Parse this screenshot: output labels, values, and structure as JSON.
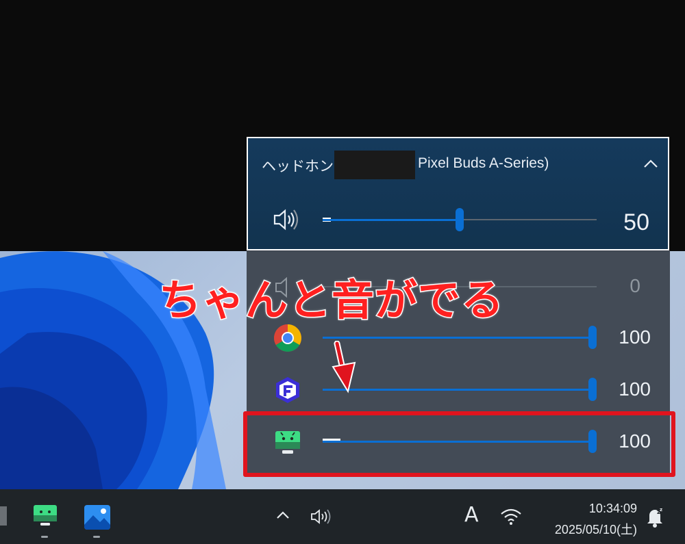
{
  "device": {
    "name_prefix": "ヘッドホン (",
    "name_model": "Pixel Buds A-Series)",
    "volume": "50",
    "volume_fraction": 0.5
  },
  "apps": [
    {
      "icon": "system-sounds-icon",
      "value": "0",
      "level": 0.0
    },
    {
      "icon": "chrome-icon",
      "value": "100",
      "level": 1.0
    },
    {
      "icon": "floorp-icon",
      "value": "100",
      "level": 1.0
    },
    {
      "icon": "android-subsystem-icon",
      "value": "100",
      "level": 1.0
    }
  ],
  "annotation": {
    "headline": "ちゃんと音がでる"
  },
  "taskbar": {
    "ime": "A",
    "time": "10:34:09",
    "date": "2025/05/10(土)"
  },
  "colors": {
    "accent": "#0a6fd4",
    "annotation_red": "#e0141e",
    "device_panel": "#12334f",
    "mixer_panel": "#3e4650",
    "taskbar": "#1f2428"
  }
}
